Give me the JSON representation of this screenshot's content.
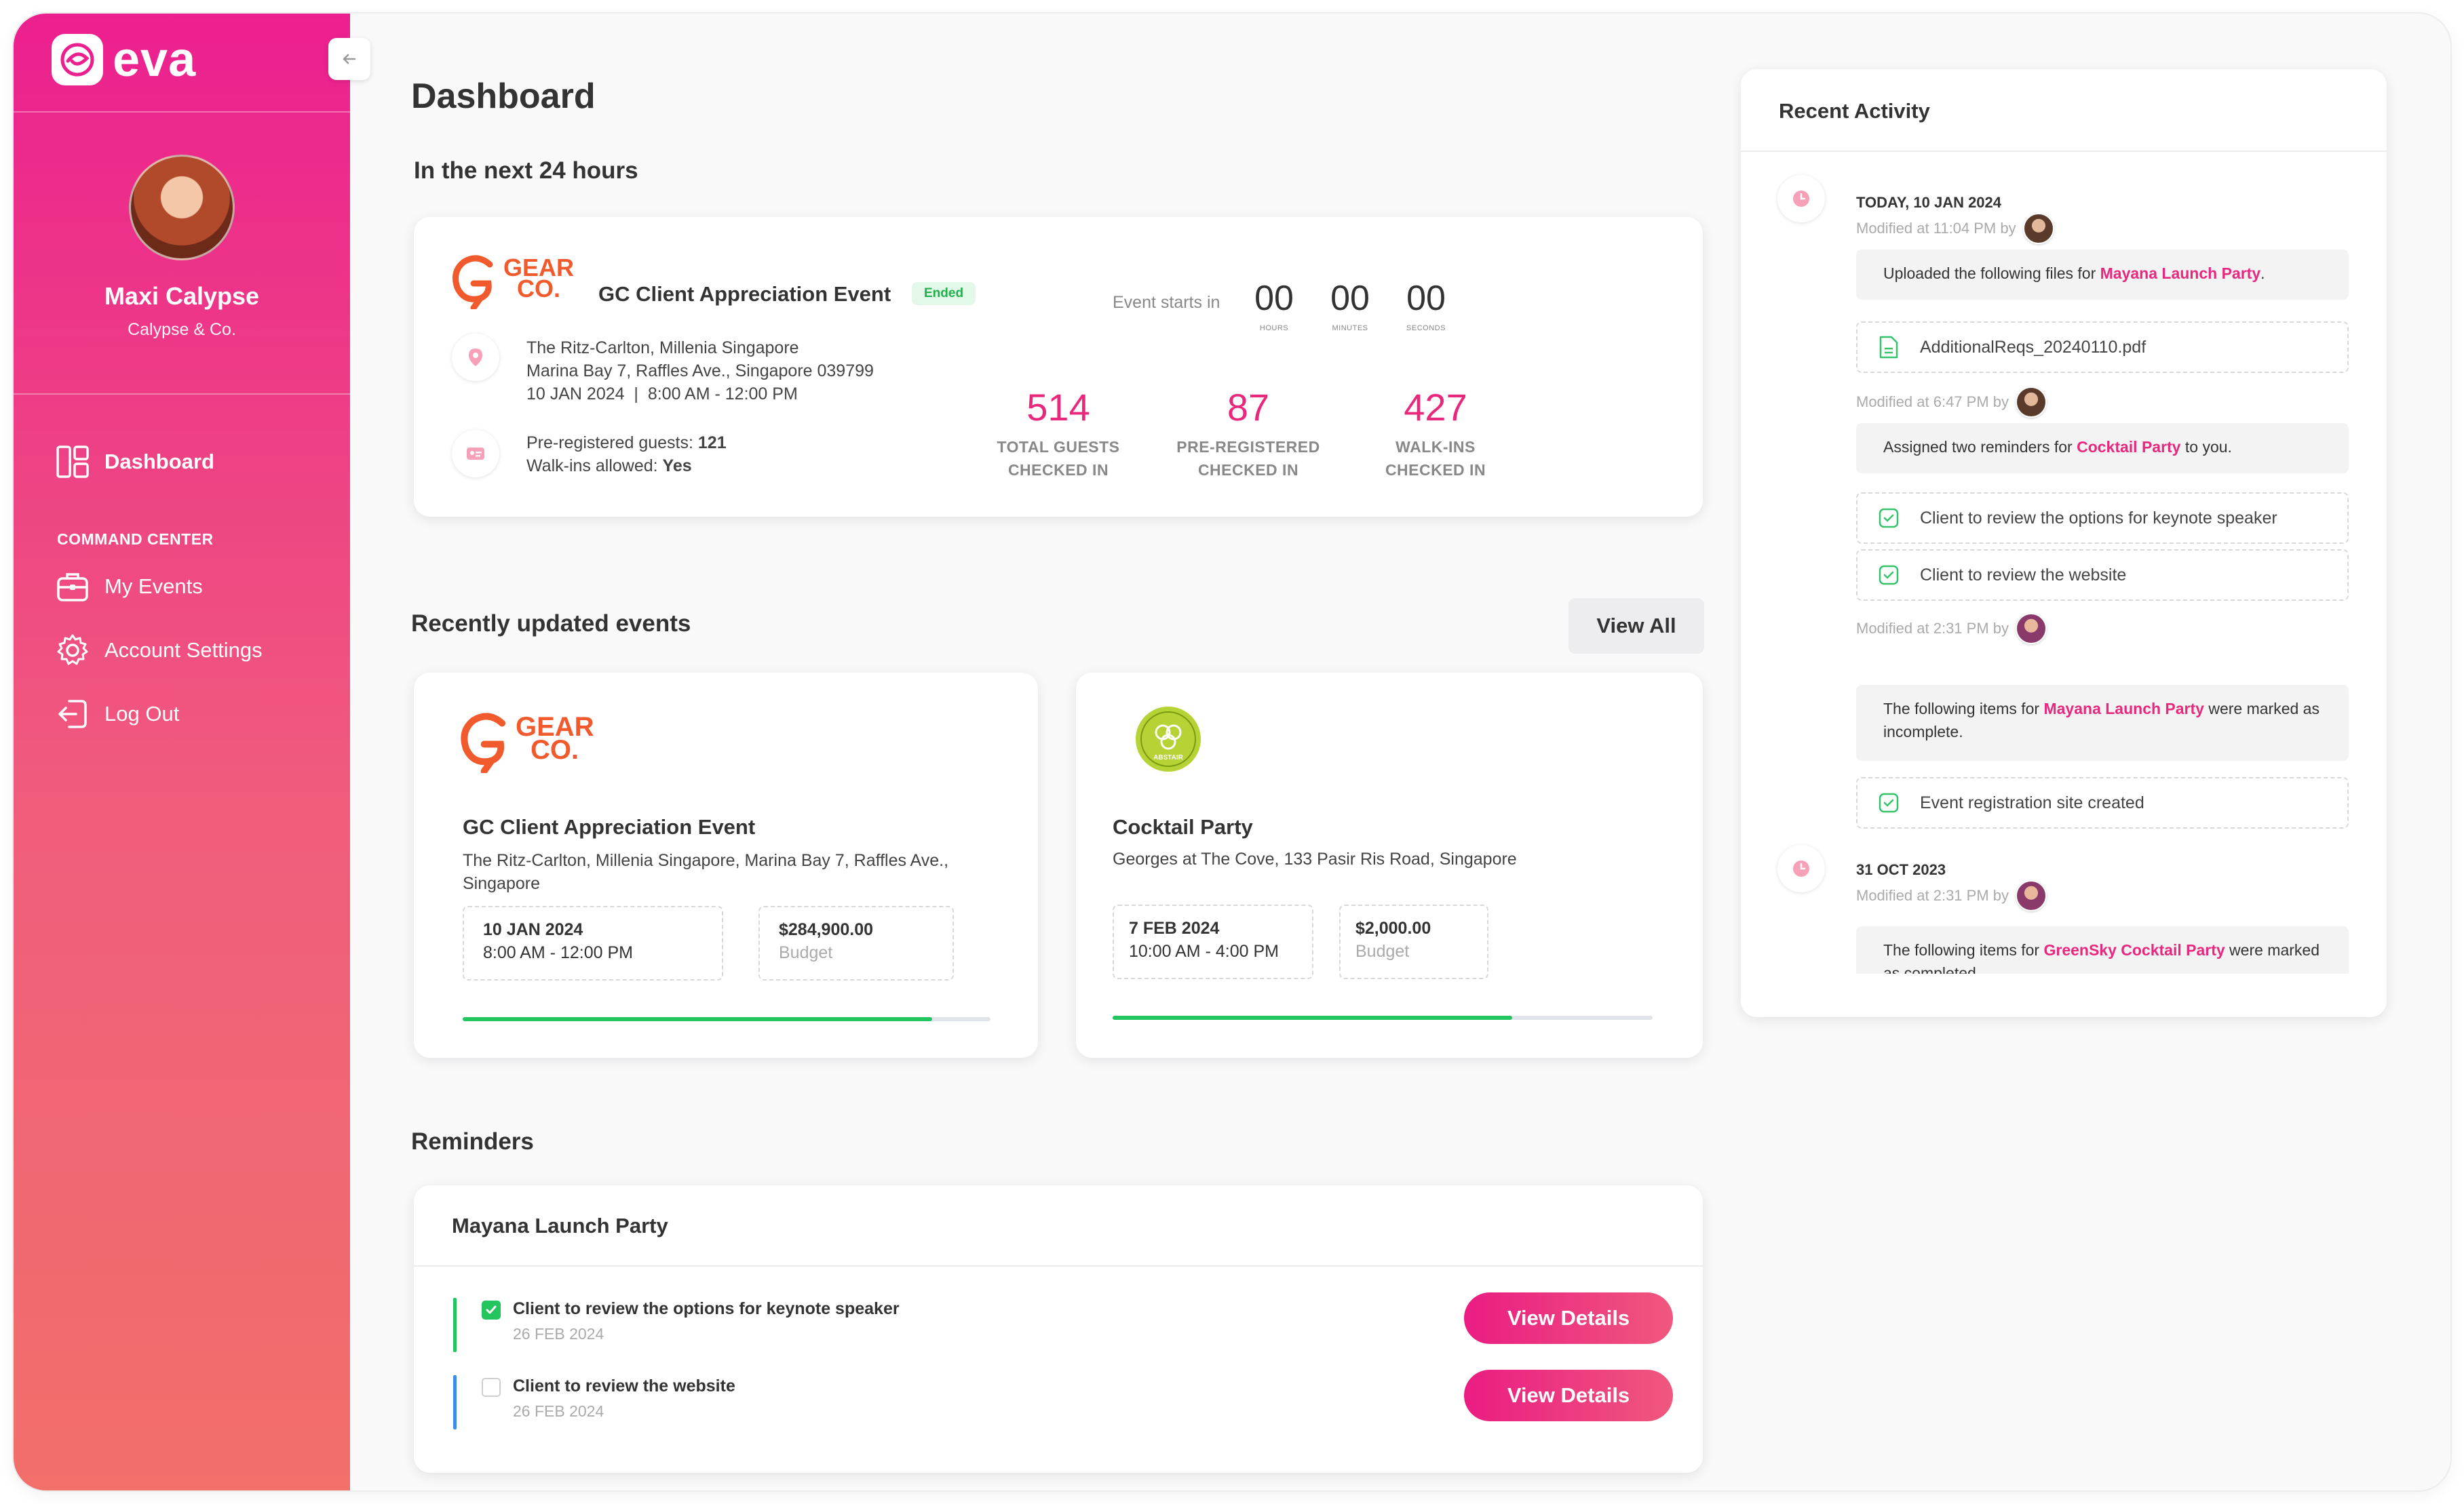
{
  "app": {
    "name": "eva"
  },
  "user": {
    "name": "Maxi Calypse",
    "org": "Calypse & Co."
  },
  "nav": {
    "dashboard": "Dashboard",
    "section": "COMMAND CENTER",
    "my_events": "My Events",
    "account_settings": "Account Settings",
    "logout": "Log Out"
  },
  "page": {
    "title": "Dashboard"
  },
  "next24": {
    "heading": "In the next 24 hours",
    "event": {
      "logo_line1": "GEAR",
      "logo_line2": "CO.",
      "title": "GC Client Appreciation Event",
      "status": "Ended",
      "venue": "The Ritz-Carlton, Millenia Singapore",
      "address": "Marina Bay 7, Raffles Ave., Singapore 039799",
      "datetime": "10 JAN 2024  |  8:00 AM - 12:00 PM",
      "prereg_label": "Pre-registered guests:",
      "prereg_value": "121",
      "walkins_label": "Walk-ins allowed:",
      "walkins_value": "Yes"
    },
    "countdown": {
      "label": "Event starts in",
      "hours": "00",
      "hours_unit": "HOURS",
      "minutes": "00",
      "minutes_unit": "MINUTES",
      "seconds": "00",
      "seconds_unit": "SECONDS"
    },
    "stats": [
      {
        "value": "514",
        "line1": "TOTAL GUESTS",
        "line2": "CHECKED IN"
      },
      {
        "value": "87",
        "line1": "PRE-REGISTERED",
        "line2": "CHECKED IN"
      },
      {
        "value": "427",
        "line1": "WALK-INS",
        "line2": "CHECKED IN"
      }
    ]
  },
  "recent": {
    "heading": "Recently updated events",
    "view_all": "View All",
    "events": [
      {
        "logo_line1": "GEAR",
        "logo_line2": "CO.",
        "title": "GC Client Appreciation Event",
        "location": "The Ritz-Carlton, Millenia Singapore, Marina Bay 7, Raffles Ave., Singapore",
        "date": "10 JAN 2024",
        "time": "8:00 AM - 12:00 PM",
        "budget": "$284,900.00",
        "budget_label": "Budget",
        "progress": 0.89
      },
      {
        "logo_text": "ABSTAIR",
        "title": "Cocktail Party",
        "location": "Georges at The Cove, 133 Pasir Ris Road, Singapore",
        "date": "7 FEB 2024",
        "time": "10:00 AM - 4:00 PM",
        "budget": "$2,000.00",
        "budget_label": "Budget",
        "progress": 0.74
      }
    ]
  },
  "reminders": {
    "heading": "Reminders",
    "group_title": "Mayana Launch Party",
    "items": [
      {
        "text": "Client to review the options for keynote speaker",
        "date": "26 FEB 2024",
        "checked": true,
        "bar_color": "#22c55e",
        "button": "View Details"
      },
      {
        "text": "Client to review the website",
        "date": "26 FEB 2024",
        "checked": false,
        "bar_color": "#3b8ced",
        "button": "View Details"
      }
    ]
  },
  "activity": {
    "title": "Recent Activity",
    "days": [
      {
        "date": "TODAY, 10 JAN 2024",
        "entries": [
          {
            "modified": "Modified at 11:04 PM by",
            "msg_pre": "Uploaded the following files for ",
            "msg_hl": "Mayana Launch Party",
            "msg_post": ".",
            "items": [
              "AdditionalReqs_20240110.pdf"
            ]
          },
          {
            "modified": "Modified at 6:47 PM by",
            "msg_pre": "Assigned two reminders for ",
            "msg_hl": "Cocktail Party",
            "msg_post": " to you.",
            "items": [
              "Client to review the options for keynote speaker",
              "Client to review the website"
            ]
          },
          {
            "modified": "Modified at 2:31 PM by",
            "msg_pre": "The following items for ",
            "msg_hl": "Mayana Launch Party",
            "msg_post": " were marked as incomplete.",
            "items": [
              "Event registration site created"
            ]
          }
        ]
      },
      {
        "date": "31 OCT 2023",
        "entries": [
          {
            "modified": "Modified at 2:31 PM by",
            "msg_pre": "The following items for ",
            "msg_hl": "GreenSky Cocktail Party",
            "msg_post": " were marked as completed."
          }
        ]
      }
    ]
  }
}
